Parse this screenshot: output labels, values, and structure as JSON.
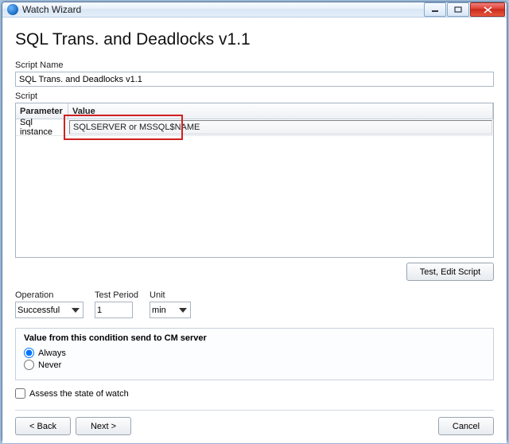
{
  "window": {
    "title": "Watch Wizard"
  },
  "heading": "SQL Trans. and Deadlocks v1.1",
  "scriptName": {
    "label": "Script Name",
    "value": "SQL Trans. and Deadlocks v1.1"
  },
  "script": {
    "label": "Script",
    "columns": {
      "parameter": "Parameter",
      "value": "Value"
    },
    "rows": [
      {
        "parameter": "Sql instance",
        "value": "SQLSERVER or MSSQL$NAME"
      }
    ]
  },
  "buttons": {
    "testEdit": "Test, Edit Script",
    "back": "< Back",
    "next": "Next >",
    "cancel": "Cancel"
  },
  "operation": {
    "label": "Operation",
    "value": "Successful"
  },
  "testPeriod": {
    "label": "Test Period",
    "value": "1"
  },
  "unit": {
    "label": "Unit",
    "value": "min"
  },
  "condition": {
    "title": "Value from this condition send to CM server",
    "always": "Always",
    "never": "Never",
    "selected": "always"
  },
  "assess": {
    "label": "Assess the state of watch",
    "checked": false
  }
}
